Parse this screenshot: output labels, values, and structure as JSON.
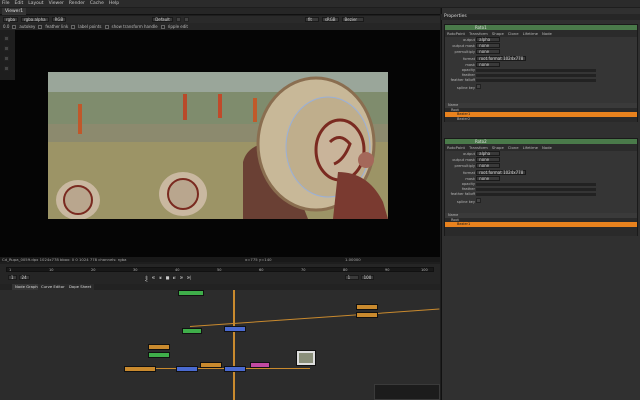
{
  "menubar": {
    "items": [
      "File",
      "Edit",
      "Layout",
      "Viewer",
      "Render",
      "Cache",
      "Help"
    ]
  },
  "viewer": {
    "tab_label": "Viewer1",
    "channels": "rgba",
    "channel2": "rgba.alpha",
    "colorspace": "RGB",
    "view_dropdown": "Default",
    "gain": "1",
    "zoom": "fit",
    "frame_field": "0.0",
    "overlay_label": "Bezier",
    "lut": "sRGB",
    "toolbar2": {
      "autokey": "autokey",
      "feather_link": "feather link",
      "label_points": "label points",
      "show_transform_handle": "show transform handle",
      "ripple_edit": "ripple edit"
    }
  },
  "infobar": {
    "text": "Cd_Rupa_0059.dpx  1024x778 bbox: 0 0 1024 778 channels: rgba",
    "coords": "x=775 y=140",
    "value": "1.00000"
  },
  "timeline": {
    "frame_start": "1",
    "frame_end": "100",
    "ticks": [
      "1",
      "10",
      "20",
      "30",
      "40",
      "50",
      "60",
      "70",
      "80",
      "90",
      "100"
    ],
    "fps": "24",
    "current_frame": "1"
  },
  "nodegraph": {
    "tabs": [
      "Node Graph",
      "Curve Editor",
      "Dope Sheet"
    ]
  },
  "properties": {
    "title": "Properties",
    "panels": [
      {
        "name": "Roto1",
        "tabs": [
          "RotoPaint",
          "Transform",
          "Shape",
          "Clone",
          "Lifetime",
          "Node"
        ],
        "rows": [
          {
            "label": "output",
            "value": "alpha"
          },
          {
            "label": "output mask",
            "value": "none"
          },
          {
            "label": "premultiply",
            "value": "none"
          },
          {
            "label": "format",
            "value": "root.format 1024x778"
          },
          {
            "label": "clip to",
            "value": ""
          },
          {
            "label": "mask",
            "value": "none"
          },
          {
            "label": "opacity",
            "value": ""
          },
          {
            "label": "feather",
            "value": ""
          },
          {
            "label": "feather falloff",
            "value": ""
          },
          {
            "label": "spline key",
            "value": ""
          }
        ],
        "layers": [
          "Name",
          "Root",
          "Bezier1",
          "Bezier2"
        ],
        "selected_layer": "Bezier1"
      },
      {
        "name": "Roto2",
        "tabs": [
          "RotoPaint",
          "Transform",
          "Shape",
          "Clone",
          "Lifetime",
          "Node"
        ],
        "rows": [
          {
            "label": "output",
            "value": "alpha"
          },
          {
            "label": "output mask",
            "value": "none"
          },
          {
            "label": "premultiply",
            "value": "none"
          },
          {
            "label": "format",
            "value": "root.format 1024x778"
          },
          {
            "label": "clip to",
            "value": ""
          },
          {
            "label": "mask",
            "value": "none"
          },
          {
            "label": "opacity",
            "value": ""
          },
          {
            "label": "feather",
            "value": ""
          },
          {
            "label": "feather falloff",
            "value": ""
          },
          {
            "label": "spline key",
            "value": ""
          }
        ],
        "layers": [
          "Name",
          "Root",
          "Bezier1"
        ],
        "selected_layer": "Bezier1"
      }
    ]
  },
  "colors": {
    "accent_orange": "#e8821e",
    "header_green": "#4a7a4a",
    "node_orange": "#c98a2e",
    "node_blue": "#4a6ad0",
    "node_green": "#3fae4a",
    "node_pink": "#c24aa0"
  }
}
